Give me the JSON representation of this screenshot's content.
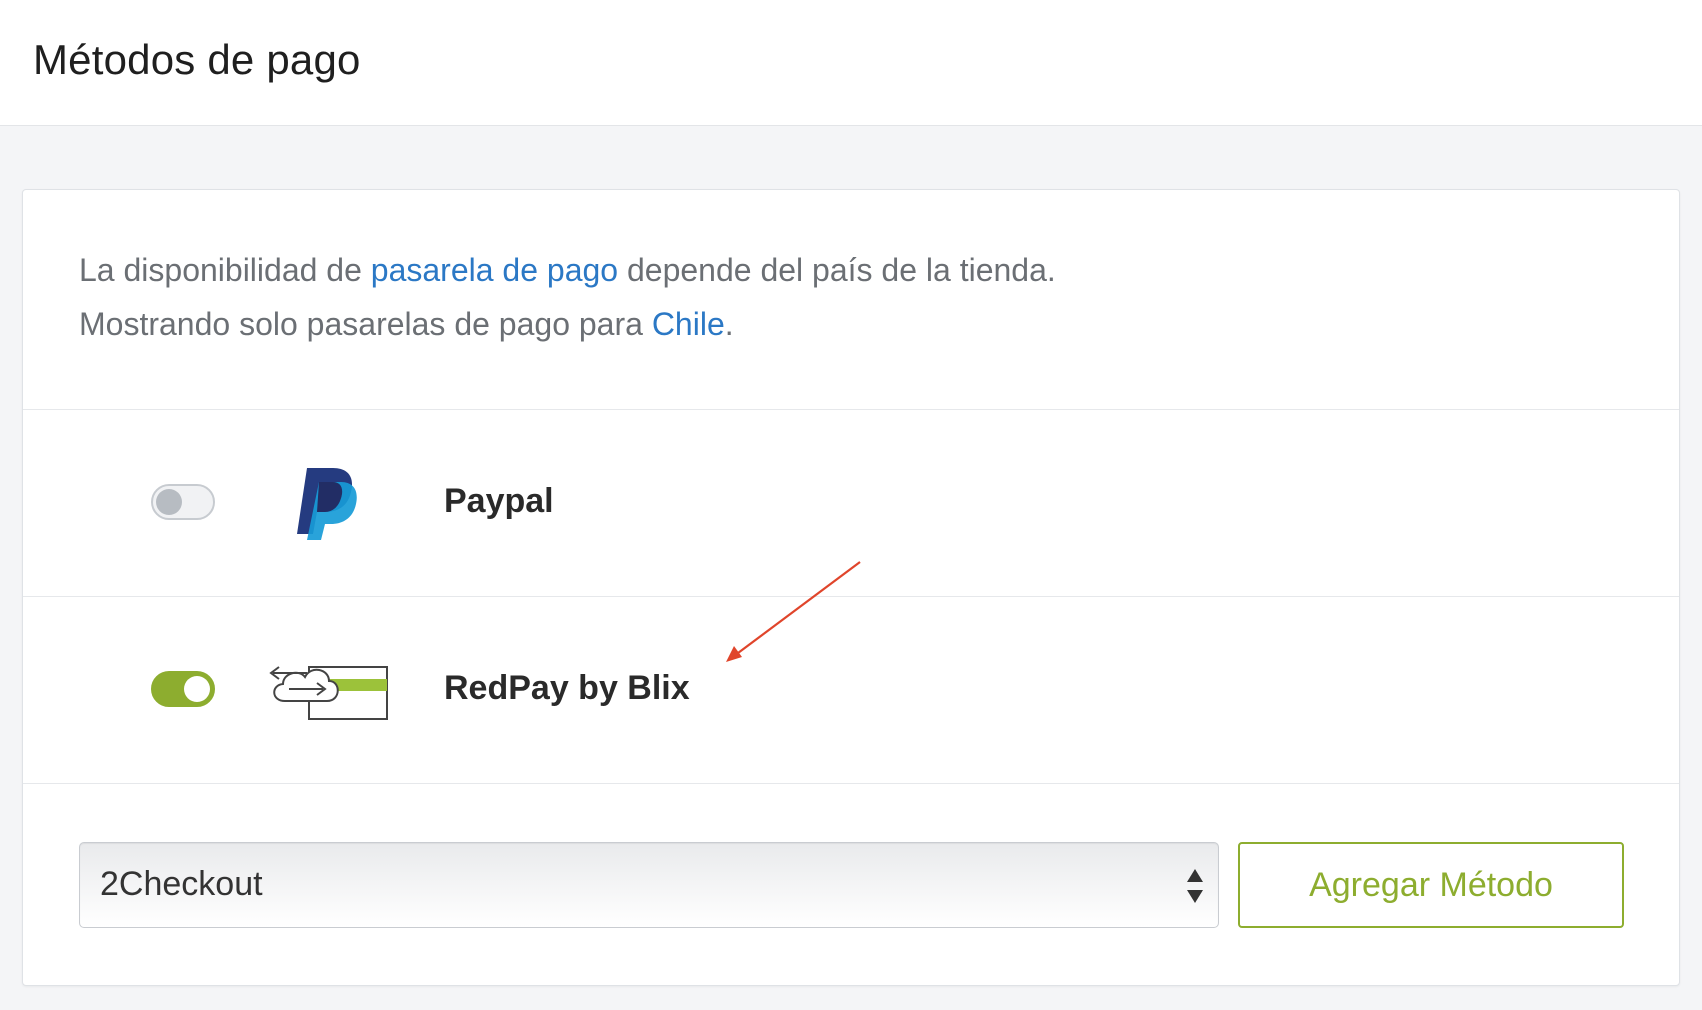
{
  "page": {
    "title": "Métodos de pago"
  },
  "info": {
    "line1_pre": "La disponibilidad de ",
    "line1_link": "pasarela de pago",
    "line1_post": " depende del país de la tienda.",
    "line2_pre": "Mostrando solo pasarelas de pago para ",
    "line2_link": "Chile",
    "line2_post": "."
  },
  "methods": [
    {
      "name": "Paypal",
      "enabled": false,
      "icon": "paypal-logo-icon"
    },
    {
      "name": "RedPay by Blix",
      "enabled": true,
      "icon": "redpay-cloud-card-icon"
    }
  ],
  "add_method": {
    "selected": "2Checkout",
    "button_label": "Agregar Método"
  },
  "colors": {
    "accent_green": "#8dad2f",
    "link_blue": "#2b78c5",
    "annotation_red": "#e0452b"
  }
}
